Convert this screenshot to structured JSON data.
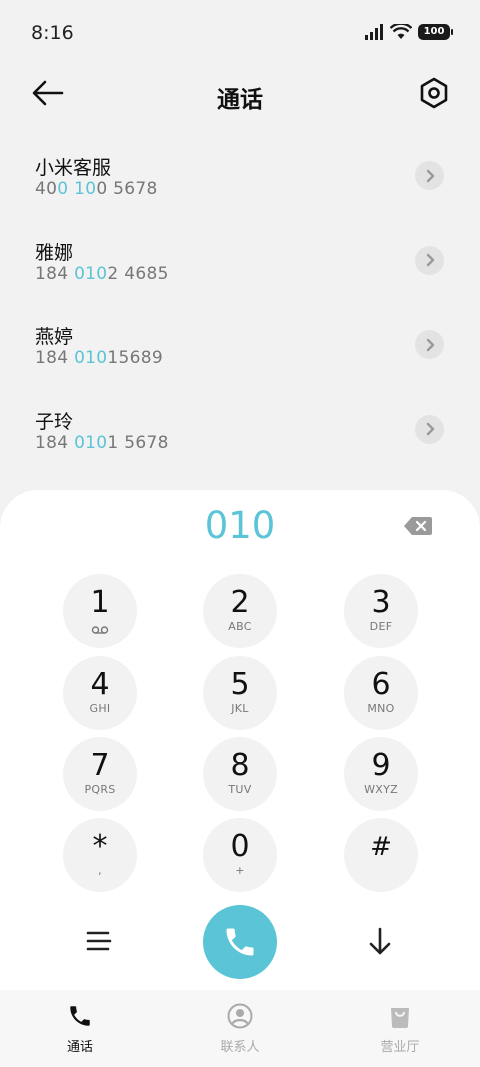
{
  "status_bar": {
    "time": "8:16",
    "battery": "100",
    "icons": [
      "signal-icon",
      "wifi-icon",
      "battery-icon"
    ]
  },
  "header": {
    "title": "通话",
    "back_icon": "arrow-left-icon",
    "settings_icon": "hexagon-settings-icon"
  },
  "contacts": [
    {
      "name": "小米客服",
      "number_parts": [
        [
          "40",
          false
        ],
        [
          "0",
          true
        ],
        [
          " ",
          false
        ],
        [
          "10",
          true
        ],
        [
          "0 5678",
          false
        ]
      ]
    },
    {
      "name": "雅娜",
      "number_parts": [
        [
          "184 ",
          false
        ],
        [
          "010",
          true
        ],
        [
          "2 4685",
          false
        ]
      ]
    },
    {
      "name": "燕婷",
      "number_parts": [
        [
          "184 ",
          false
        ],
        [
          "010",
          true
        ],
        [
          "15689",
          false
        ]
      ]
    },
    {
      "name": "子玲",
      "number_parts": [
        [
          "184 ",
          false
        ],
        [
          "010",
          true
        ],
        [
          "1 5678",
          false
        ]
      ]
    }
  ],
  "dialer": {
    "input": "010",
    "keys": [
      {
        "digit": "1",
        "sub": "",
        "sub_icon": "voicemail-icon"
      },
      {
        "digit": "2",
        "sub": "ABC"
      },
      {
        "digit": "3",
        "sub": "DEF"
      },
      {
        "digit": "4",
        "sub": "GHI"
      },
      {
        "digit": "5",
        "sub": "JKL"
      },
      {
        "digit": "6",
        "sub": "MNO"
      },
      {
        "digit": "7",
        "sub": "PQRS"
      },
      {
        "digit": "8",
        "sub": "TUV"
      },
      {
        "digit": "9",
        "sub": "WXYZ"
      },
      {
        "digit": "*",
        "sub": ","
      },
      {
        "digit": "0",
        "sub": "+"
      },
      {
        "digit": "#",
        "sub": ""
      }
    ]
  },
  "bottom_nav": {
    "items": [
      {
        "label": "通话",
        "icon": "phone-icon",
        "active": true
      },
      {
        "label": "联系人",
        "icon": "person-circle-icon",
        "active": false
      },
      {
        "label": "营业厅",
        "icon": "shopping-bag-icon",
        "active": false
      }
    ]
  },
  "colors": {
    "accent": "#5bc4d6",
    "background": "#f2f2f2",
    "sheet": "#ffffff",
    "key": "#f2f2f2"
  }
}
